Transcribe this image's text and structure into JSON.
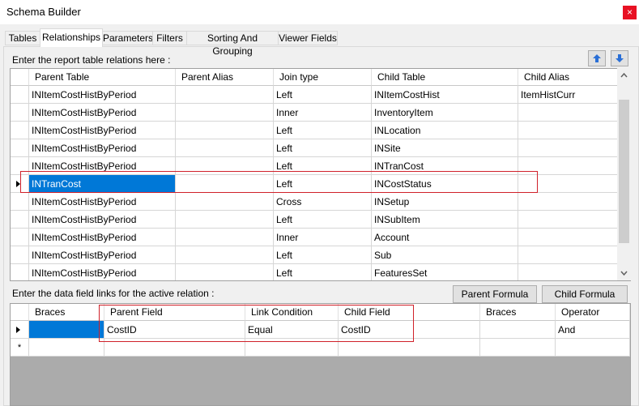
{
  "window": {
    "title": "Schema Builder",
    "close_glyph": "×"
  },
  "tabs": [
    "Tables",
    "Relationships",
    "Parameters",
    "Filters",
    "Sorting And Grouping",
    "Viewer Fields"
  ],
  "relations": {
    "label": "Enter the report table relations here :",
    "columns": [
      "Parent Table",
      "Parent Alias",
      "Join type",
      "Child Table",
      "Child Alias"
    ],
    "rows": [
      {
        "parent_table": "INItemCostHistByPeriod",
        "parent_alias": "",
        "join_type": "Left",
        "child_table": "INItemCostHist",
        "child_alias": "ItemHistCurr"
      },
      {
        "parent_table": "INItemCostHistByPeriod",
        "parent_alias": "",
        "join_type": "Inner",
        "child_table": "InventoryItem",
        "child_alias": ""
      },
      {
        "parent_table": "INItemCostHistByPeriod",
        "parent_alias": "",
        "join_type": "Left",
        "child_table": "INLocation",
        "child_alias": ""
      },
      {
        "parent_table": "INItemCostHistByPeriod",
        "parent_alias": "",
        "join_type": "Left",
        "child_table": "INSite",
        "child_alias": ""
      },
      {
        "parent_table": "INItemCostHistByPeriod",
        "parent_alias": "",
        "join_type": "Left",
        "child_table": "INTranCost",
        "child_alias": ""
      },
      {
        "parent_table": "INTranCost",
        "parent_alias": "",
        "join_type": "Left",
        "child_table": "INCostStatus",
        "child_alias": ""
      },
      {
        "parent_table": "INItemCostHistByPeriod",
        "parent_alias": "",
        "join_type": "Cross",
        "child_table": "INSetup",
        "child_alias": ""
      },
      {
        "parent_table": "INItemCostHistByPeriod",
        "parent_alias": "",
        "join_type": "Left",
        "child_table": "INSubItem",
        "child_alias": ""
      },
      {
        "parent_table": "INItemCostHistByPeriod",
        "parent_alias": "",
        "join_type": "Inner",
        "child_table": "Account",
        "child_alias": ""
      },
      {
        "parent_table": "INItemCostHistByPeriod",
        "parent_alias": "",
        "join_type": "Left",
        "child_table": "Sub",
        "child_alias": ""
      },
      {
        "parent_table": "INItemCostHistByPeriod",
        "parent_alias": "",
        "join_type": "Left",
        "child_table": "FeaturesSet",
        "child_alias": ""
      }
    ]
  },
  "links": {
    "label": "Enter the data field links for the active relation :",
    "parent_formula_button": "Parent Formula",
    "child_formula_button": "Child Formula",
    "columns": [
      "Braces",
      "Parent Field",
      "Link Condition",
      "Child Field",
      "Braces",
      "Operator"
    ],
    "rows": [
      {
        "braces_open": "",
        "parent_field": "CostID",
        "link_condition": "Equal",
        "child_field": "CostID",
        "braces_close": "",
        "operator": "And"
      }
    ],
    "new_row_marker": "*"
  }
}
